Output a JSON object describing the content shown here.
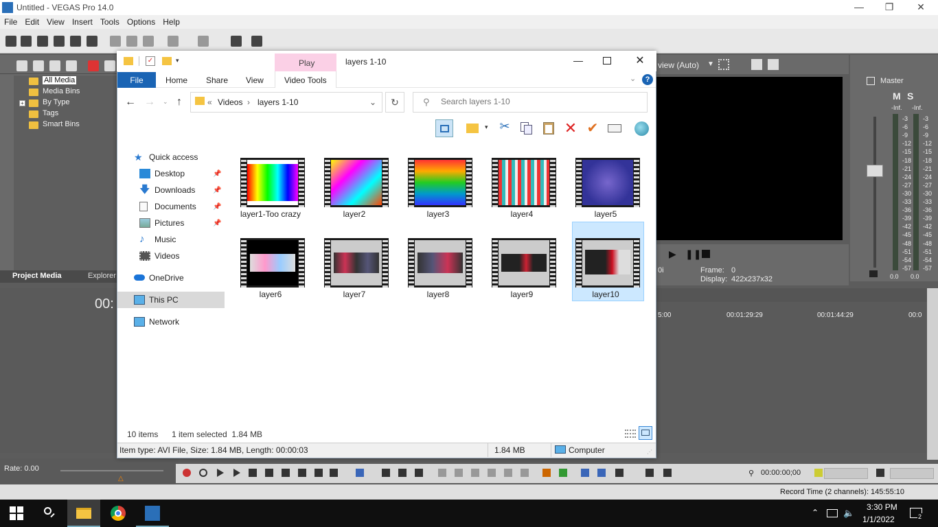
{
  "vegas": {
    "title": "Untitled - VEGAS Pro 14.0",
    "menu": [
      "File",
      "Edit",
      "View",
      "Insert",
      "Tools",
      "Options",
      "Help"
    ],
    "media_tree": [
      "All Media",
      "Media Bins",
      "By Type",
      "Tags",
      "Smart Bins"
    ],
    "tabs": {
      "project_media": "Project Media",
      "explorer": "Explorer"
    },
    "timecode": "00:",
    "rate": "Rate: 0.00",
    "preview_mode": "view (Auto)",
    "frame_label": "Frame:",
    "frame_value": "0",
    "display_label": "Display:",
    "display_value": "422x237x32",
    "fps_fragment": "0i",
    "master_label": "Master",
    "master_m": "M",
    "master_s": "S",
    "meter_scale": [
      "-Inf.",
      "3",
      "6",
      "9",
      "12",
      "15",
      "18",
      "21",
      "24",
      "27",
      "30",
      "33",
      "36",
      "39",
      "42",
      "45",
      "48",
      "51",
      "54",
      "57"
    ],
    "meter_bottom": [
      "0.0",
      "0.0"
    ],
    "ruler": [
      "5:00",
      "00:01:29:29",
      "00:01:44:29",
      "00:0"
    ],
    "transport_timecode": "00:00:00;00",
    "record_time": "Record Time (2 channels): 145:55:10"
  },
  "taskbar": {
    "time": "3:30 PM",
    "date": "1/1/2022",
    "notification_count": "2"
  },
  "explorer": {
    "title": "layers 1-10",
    "contextual_tab_group": "Play",
    "ribbon_tabs": {
      "file": "File",
      "home": "Home",
      "share": "Share",
      "view": "View",
      "video_tools": "Video Tools"
    },
    "address": {
      "overflow": "«",
      "part1": "Videos",
      "sep": "›",
      "part2": "layers 1-10"
    },
    "search_placeholder": "Search layers 1-10",
    "nav": {
      "quick_access": "Quick access",
      "desktop": "Desktop",
      "downloads": "Downloads",
      "documents": "Documents",
      "pictures": "Pictures",
      "music": "Music",
      "videos": "Videos",
      "onedrive": "OneDrive",
      "this_pc": "This PC",
      "network": "Network"
    },
    "files": [
      "layer1-Too crazy",
      "layer2",
      "layer3",
      "layer4",
      "layer5",
      "layer6",
      "layer7",
      "layer8",
      "layer9",
      "layer10"
    ],
    "selected_file": "layer10",
    "status": {
      "count": "10 items",
      "selection": "1 item selected  1.84 MB"
    },
    "info": {
      "details": "Item type: AVI File, Size: 1.84 MB, Length: 00:00:03",
      "size": "1.84 MB",
      "location": "Computer"
    }
  }
}
